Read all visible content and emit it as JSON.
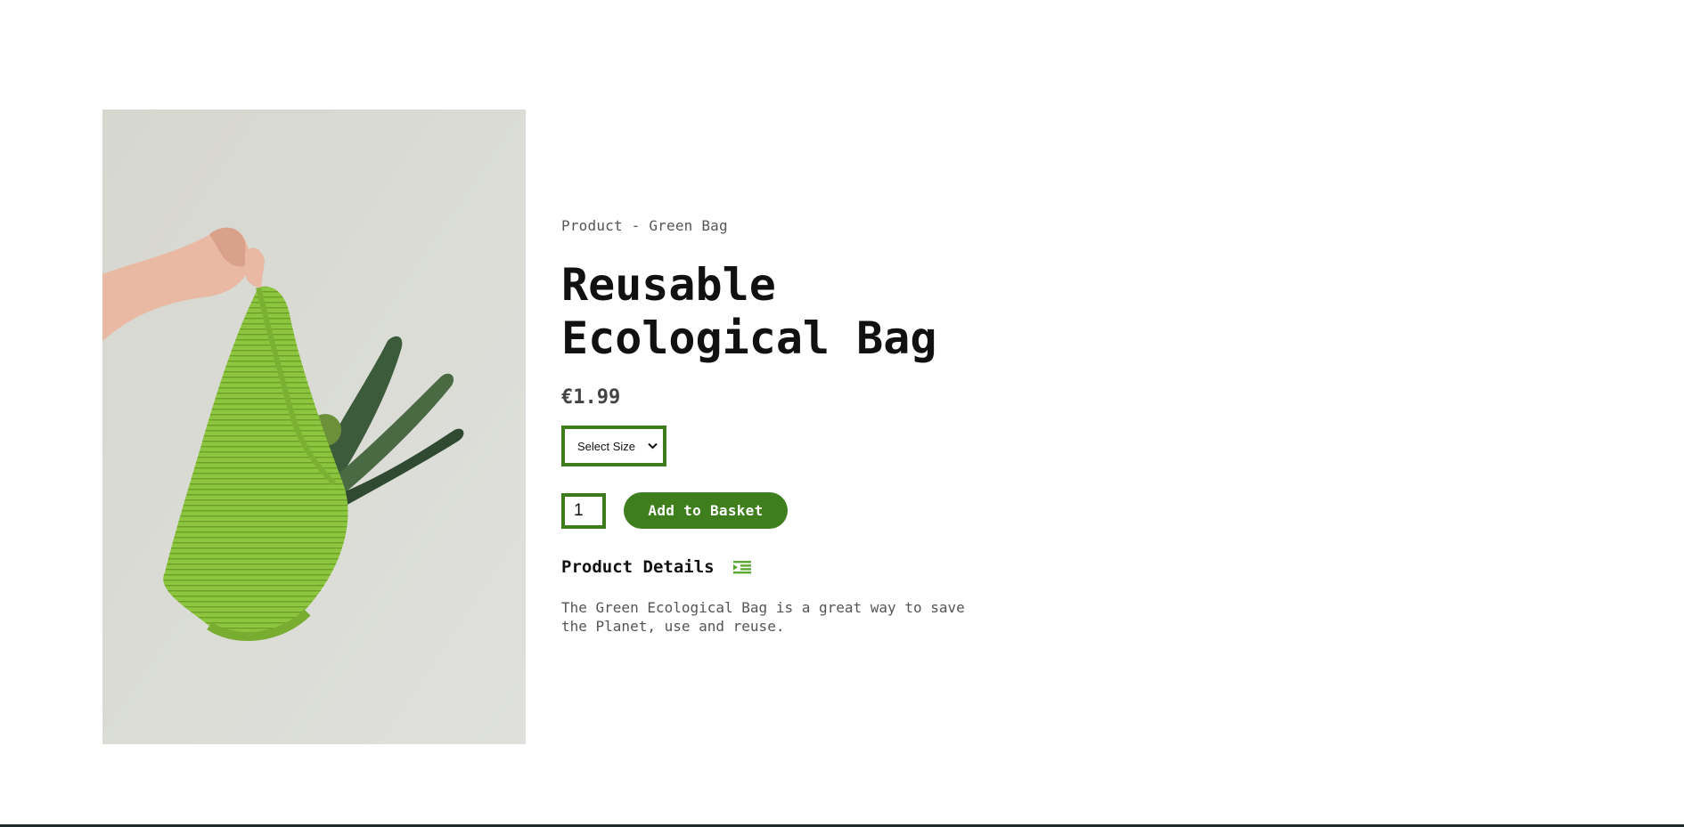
{
  "product": {
    "breadcrumb": "Product - Green Bag",
    "title_line1": "Reusable",
    "title_line2": "Ecological Bag",
    "price": "€1.99",
    "size_select": {
      "selected": "Select Size"
    },
    "quantity": "1",
    "add_to_basket_label": "Add to Basket",
    "details_heading": "Product Details",
    "description_line1": "The Green Ecological Bag is a great way to save",
    "description_line2": "the Planet, use and reuse."
  },
  "colors": {
    "accent": "#3f7e1d",
    "text": "#111111",
    "muted": "#555555"
  },
  "icons": {
    "details_toggle": "list-indent-icon",
    "select_arrow": "chevron-down-icon"
  }
}
